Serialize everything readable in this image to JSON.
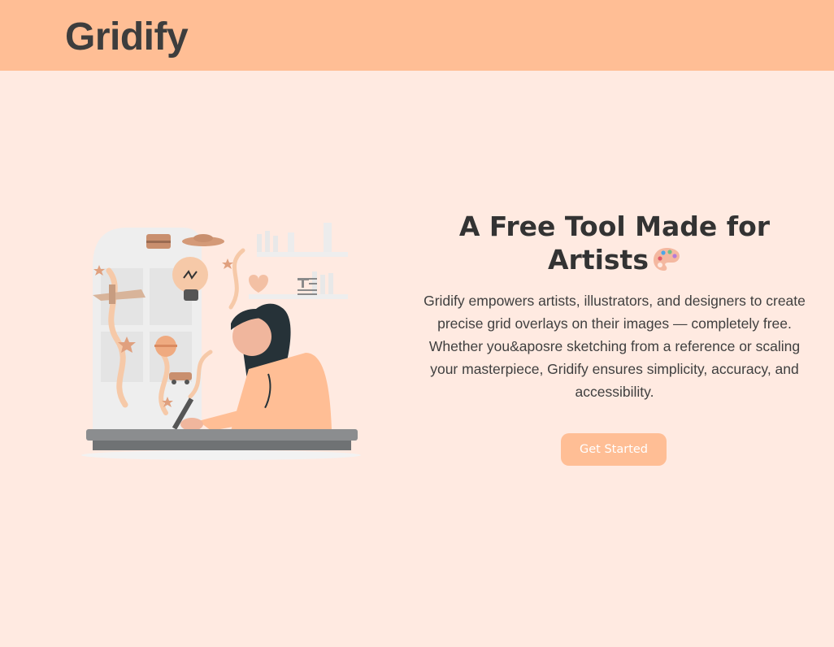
{
  "header": {
    "brand": "Gridify"
  },
  "hero": {
    "title": "A Free Tool Made for Artists",
    "title_icon": "palette-icon",
    "description": "Gridify empowers artists, illustrators, and designers to create precise grid overlays on their images — completely free. Whether you&aposre sketching from a reference or scaling your masterpiece, Gridify ensures simplicity, accuracy, and accessibility.",
    "cta_label": "Get Started",
    "illustration": "woman-drawing-illustration"
  },
  "colors": {
    "background": "#ffeae1",
    "header": "#ffbe95",
    "accent": "#ffbe95",
    "text": "#333333"
  }
}
